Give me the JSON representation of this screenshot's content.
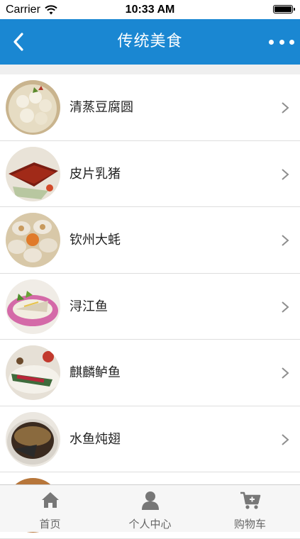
{
  "status_bar": {
    "carrier": "Carrier",
    "time": "10:33 AM"
  },
  "nav": {
    "title": "传统美食"
  },
  "items": [
    {
      "label": "清蒸豆腐圆"
    },
    {
      "label": "皮片乳猪"
    },
    {
      "label": "钦州大蚝"
    },
    {
      "label": "浔江鱼"
    },
    {
      "label": "麒麟鲈鱼"
    },
    {
      "label": "水鱼炖翅"
    }
  ],
  "tabs": [
    {
      "label": "首页",
      "icon": "home-icon"
    },
    {
      "label": "个人中心",
      "icon": "person-icon"
    },
    {
      "label": "购物车",
      "icon": "cart-icon"
    }
  ],
  "colors": {
    "nav_bg": "#1a87d2",
    "tab_icon": "#777777",
    "separator": "#dedede"
  }
}
